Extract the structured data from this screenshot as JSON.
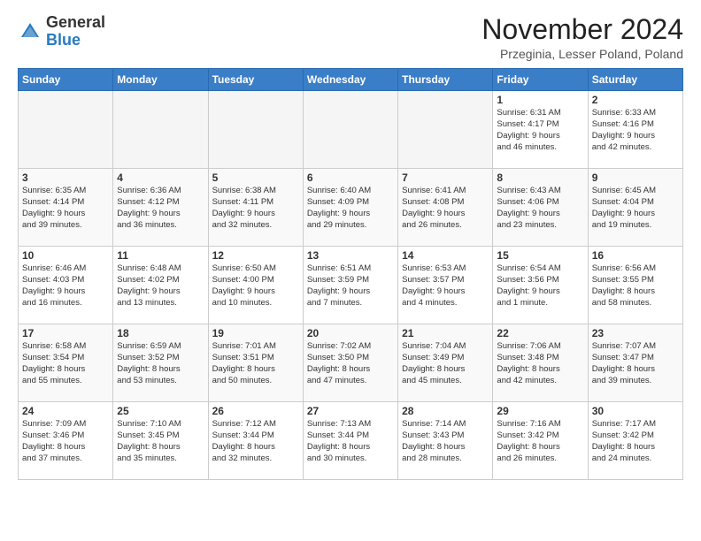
{
  "header": {
    "logo_general": "General",
    "logo_blue": "Blue",
    "month_title": "November 2024",
    "location": "Przeginia, Lesser Poland, Poland"
  },
  "days_of_week": [
    "Sunday",
    "Monday",
    "Tuesday",
    "Wednesday",
    "Thursday",
    "Friday",
    "Saturday"
  ],
  "weeks": [
    [
      {
        "day": "",
        "info": ""
      },
      {
        "day": "",
        "info": ""
      },
      {
        "day": "",
        "info": ""
      },
      {
        "day": "",
        "info": ""
      },
      {
        "day": "",
        "info": ""
      },
      {
        "day": "1",
        "info": "Sunrise: 6:31 AM\nSunset: 4:17 PM\nDaylight: 9 hours\nand 46 minutes."
      },
      {
        "day": "2",
        "info": "Sunrise: 6:33 AM\nSunset: 4:16 PM\nDaylight: 9 hours\nand 42 minutes."
      }
    ],
    [
      {
        "day": "3",
        "info": "Sunrise: 6:35 AM\nSunset: 4:14 PM\nDaylight: 9 hours\nand 39 minutes."
      },
      {
        "day": "4",
        "info": "Sunrise: 6:36 AM\nSunset: 4:12 PM\nDaylight: 9 hours\nand 36 minutes."
      },
      {
        "day": "5",
        "info": "Sunrise: 6:38 AM\nSunset: 4:11 PM\nDaylight: 9 hours\nand 32 minutes."
      },
      {
        "day": "6",
        "info": "Sunrise: 6:40 AM\nSunset: 4:09 PM\nDaylight: 9 hours\nand 29 minutes."
      },
      {
        "day": "7",
        "info": "Sunrise: 6:41 AM\nSunset: 4:08 PM\nDaylight: 9 hours\nand 26 minutes."
      },
      {
        "day": "8",
        "info": "Sunrise: 6:43 AM\nSunset: 4:06 PM\nDaylight: 9 hours\nand 23 minutes."
      },
      {
        "day": "9",
        "info": "Sunrise: 6:45 AM\nSunset: 4:04 PM\nDaylight: 9 hours\nand 19 minutes."
      }
    ],
    [
      {
        "day": "10",
        "info": "Sunrise: 6:46 AM\nSunset: 4:03 PM\nDaylight: 9 hours\nand 16 minutes."
      },
      {
        "day": "11",
        "info": "Sunrise: 6:48 AM\nSunset: 4:02 PM\nDaylight: 9 hours\nand 13 minutes."
      },
      {
        "day": "12",
        "info": "Sunrise: 6:50 AM\nSunset: 4:00 PM\nDaylight: 9 hours\nand 10 minutes."
      },
      {
        "day": "13",
        "info": "Sunrise: 6:51 AM\nSunset: 3:59 PM\nDaylight: 9 hours\nand 7 minutes."
      },
      {
        "day": "14",
        "info": "Sunrise: 6:53 AM\nSunset: 3:57 PM\nDaylight: 9 hours\nand 4 minutes."
      },
      {
        "day": "15",
        "info": "Sunrise: 6:54 AM\nSunset: 3:56 PM\nDaylight: 9 hours\nand 1 minute."
      },
      {
        "day": "16",
        "info": "Sunrise: 6:56 AM\nSunset: 3:55 PM\nDaylight: 8 hours\nand 58 minutes."
      }
    ],
    [
      {
        "day": "17",
        "info": "Sunrise: 6:58 AM\nSunset: 3:54 PM\nDaylight: 8 hours\nand 55 minutes."
      },
      {
        "day": "18",
        "info": "Sunrise: 6:59 AM\nSunset: 3:52 PM\nDaylight: 8 hours\nand 53 minutes."
      },
      {
        "day": "19",
        "info": "Sunrise: 7:01 AM\nSunset: 3:51 PM\nDaylight: 8 hours\nand 50 minutes."
      },
      {
        "day": "20",
        "info": "Sunrise: 7:02 AM\nSunset: 3:50 PM\nDaylight: 8 hours\nand 47 minutes."
      },
      {
        "day": "21",
        "info": "Sunrise: 7:04 AM\nSunset: 3:49 PM\nDaylight: 8 hours\nand 45 minutes."
      },
      {
        "day": "22",
        "info": "Sunrise: 7:06 AM\nSunset: 3:48 PM\nDaylight: 8 hours\nand 42 minutes."
      },
      {
        "day": "23",
        "info": "Sunrise: 7:07 AM\nSunset: 3:47 PM\nDaylight: 8 hours\nand 39 minutes."
      }
    ],
    [
      {
        "day": "24",
        "info": "Sunrise: 7:09 AM\nSunset: 3:46 PM\nDaylight: 8 hours\nand 37 minutes."
      },
      {
        "day": "25",
        "info": "Sunrise: 7:10 AM\nSunset: 3:45 PM\nDaylight: 8 hours\nand 35 minutes."
      },
      {
        "day": "26",
        "info": "Sunrise: 7:12 AM\nSunset: 3:44 PM\nDaylight: 8 hours\nand 32 minutes."
      },
      {
        "day": "27",
        "info": "Sunrise: 7:13 AM\nSunset: 3:44 PM\nDaylight: 8 hours\nand 30 minutes."
      },
      {
        "day": "28",
        "info": "Sunrise: 7:14 AM\nSunset: 3:43 PM\nDaylight: 8 hours\nand 28 minutes."
      },
      {
        "day": "29",
        "info": "Sunrise: 7:16 AM\nSunset: 3:42 PM\nDaylight: 8 hours\nand 26 minutes."
      },
      {
        "day": "30",
        "info": "Sunrise: 7:17 AM\nSunset: 3:42 PM\nDaylight: 8 hours\nand 24 minutes."
      }
    ]
  ]
}
